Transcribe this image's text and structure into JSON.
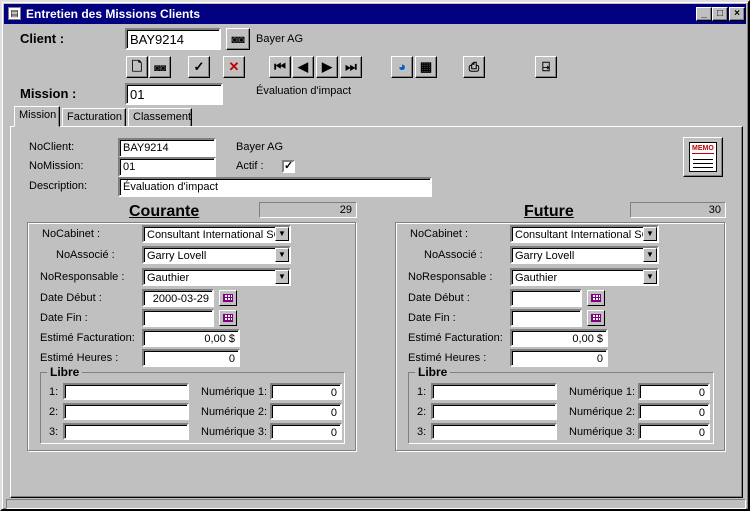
{
  "window": {
    "title": "Entretien des Missions Clients",
    "controls": {
      "minimize": "_",
      "maximize": "□",
      "close": "×"
    }
  },
  "header": {
    "client_label": "Client :",
    "client_value": "BAY9214",
    "client_name": "Bayer AG",
    "mission_label": "Mission :",
    "mission_value": "01",
    "mission_name": "Évaluation d'impact"
  },
  "toolbar": {
    "buttons": [
      "new-record-icon",
      "find-icon",
      "save-check-icon",
      "delete-x-icon",
      "first-record-icon",
      "previous-record-icon",
      "next-record-icon",
      "last-record-icon",
      "wizard-icon",
      "table-view-icon",
      "print-icon",
      "exit-door-icon"
    ]
  },
  "tabs": [
    {
      "label": "Mission"
    },
    {
      "label": "Facturation"
    },
    {
      "label": "Classement"
    }
  ],
  "mission_tab": {
    "noclient_label": "NoClient:",
    "noclient_value": "BAY9214",
    "client_name": "Bayer AG",
    "nomission_label": "NoMission:",
    "nomission_value": "01",
    "actif_label": "Actif :",
    "actif_checked": true,
    "actif_mark": "✓",
    "description_label": "Description:",
    "description_value": "Évaluation d'impact"
  },
  "courante": {
    "title": "Courante",
    "counter": "29",
    "nocabinet_label": "NoCabinet :",
    "nocabinet_value": "Consultant International SC",
    "noassocie_label": "NoAssocié :",
    "noassocie_value": "Garry Lovell",
    "noresponsable_label": "NoResponsable :",
    "noresponsable_value": "Gauthier",
    "date_debut_label": "Date Début :",
    "date_debut_value": "2000-03-29",
    "date_fin_label": "Date Fin :",
    "date_fin_value": "",
    "estime_fact_label": "Estimé Facturation:",
    "estime_fact_value": "0,00 $",
    "estime_heures_label": "Estimé Heures :",
    "estime_heures_value": "0",
    "libre_title": "Libre",
    "libre_rows": [
      {
        "label": "1:",
        "text": "",
        "num_label": "Numérique 1:",
        "num_value": "0"
      },
      {
        "label": "2:",
        "text": "",
        "num_label": "Numérique 2:",
        "num_value": "0"
      },
      {
        "label": "3:",
        "text": "",
        "num_label": "Numérique 3:",
        "num_value": "0"
      }
    ]
  },
  "future": {
    "title": "Future",
    "counter": "30",
    "nocabinet_label": "NoCabinet :",
    "nocabinet_value": "Consultant International SC",
    "noassocie_label": "NoAssocié :",
    "noassocie_value": "Garry Lovell",
    "noresponsable_label": "NoResponsable :",
    "noresponsable_value": "Gauthier",
    "date_debut_label": "Date Début :",
    "date_debut_value": "",
    "date_fin_label": "Date Fin :",
    "date_fin_value": "",
    "estime_fact_label": "Estimé Facturation:",
    "estime_fact_value": "0,00 $",
    "estime_heures_label": "Estimé Heures :",
    "estime_heures_value": "0",
    "libre_title": "Libre",
    "libre_rows": [
      {
        "label": "1:",
        "text": "",
        "num_label": "Numérique 1:",
        "num_value": "0"
      },
      {
        "label": "2:",
        "text": "",
        "num_label": "Numérique 2:",
        "num_value": "0"
      },
      {
        "label": "3:",
        "text": "",
        "num_label": "Numérique 3:",
        "num_value": "0"
      }
    ]
  },
  "memo": {
    "label": "MEMO"
  },
  "colors": {
    "titlebar": "#000080",
    "face": "#c0c0c0",
    "calendar": "#800080",
    "memo": "#c00000"
  }
}
